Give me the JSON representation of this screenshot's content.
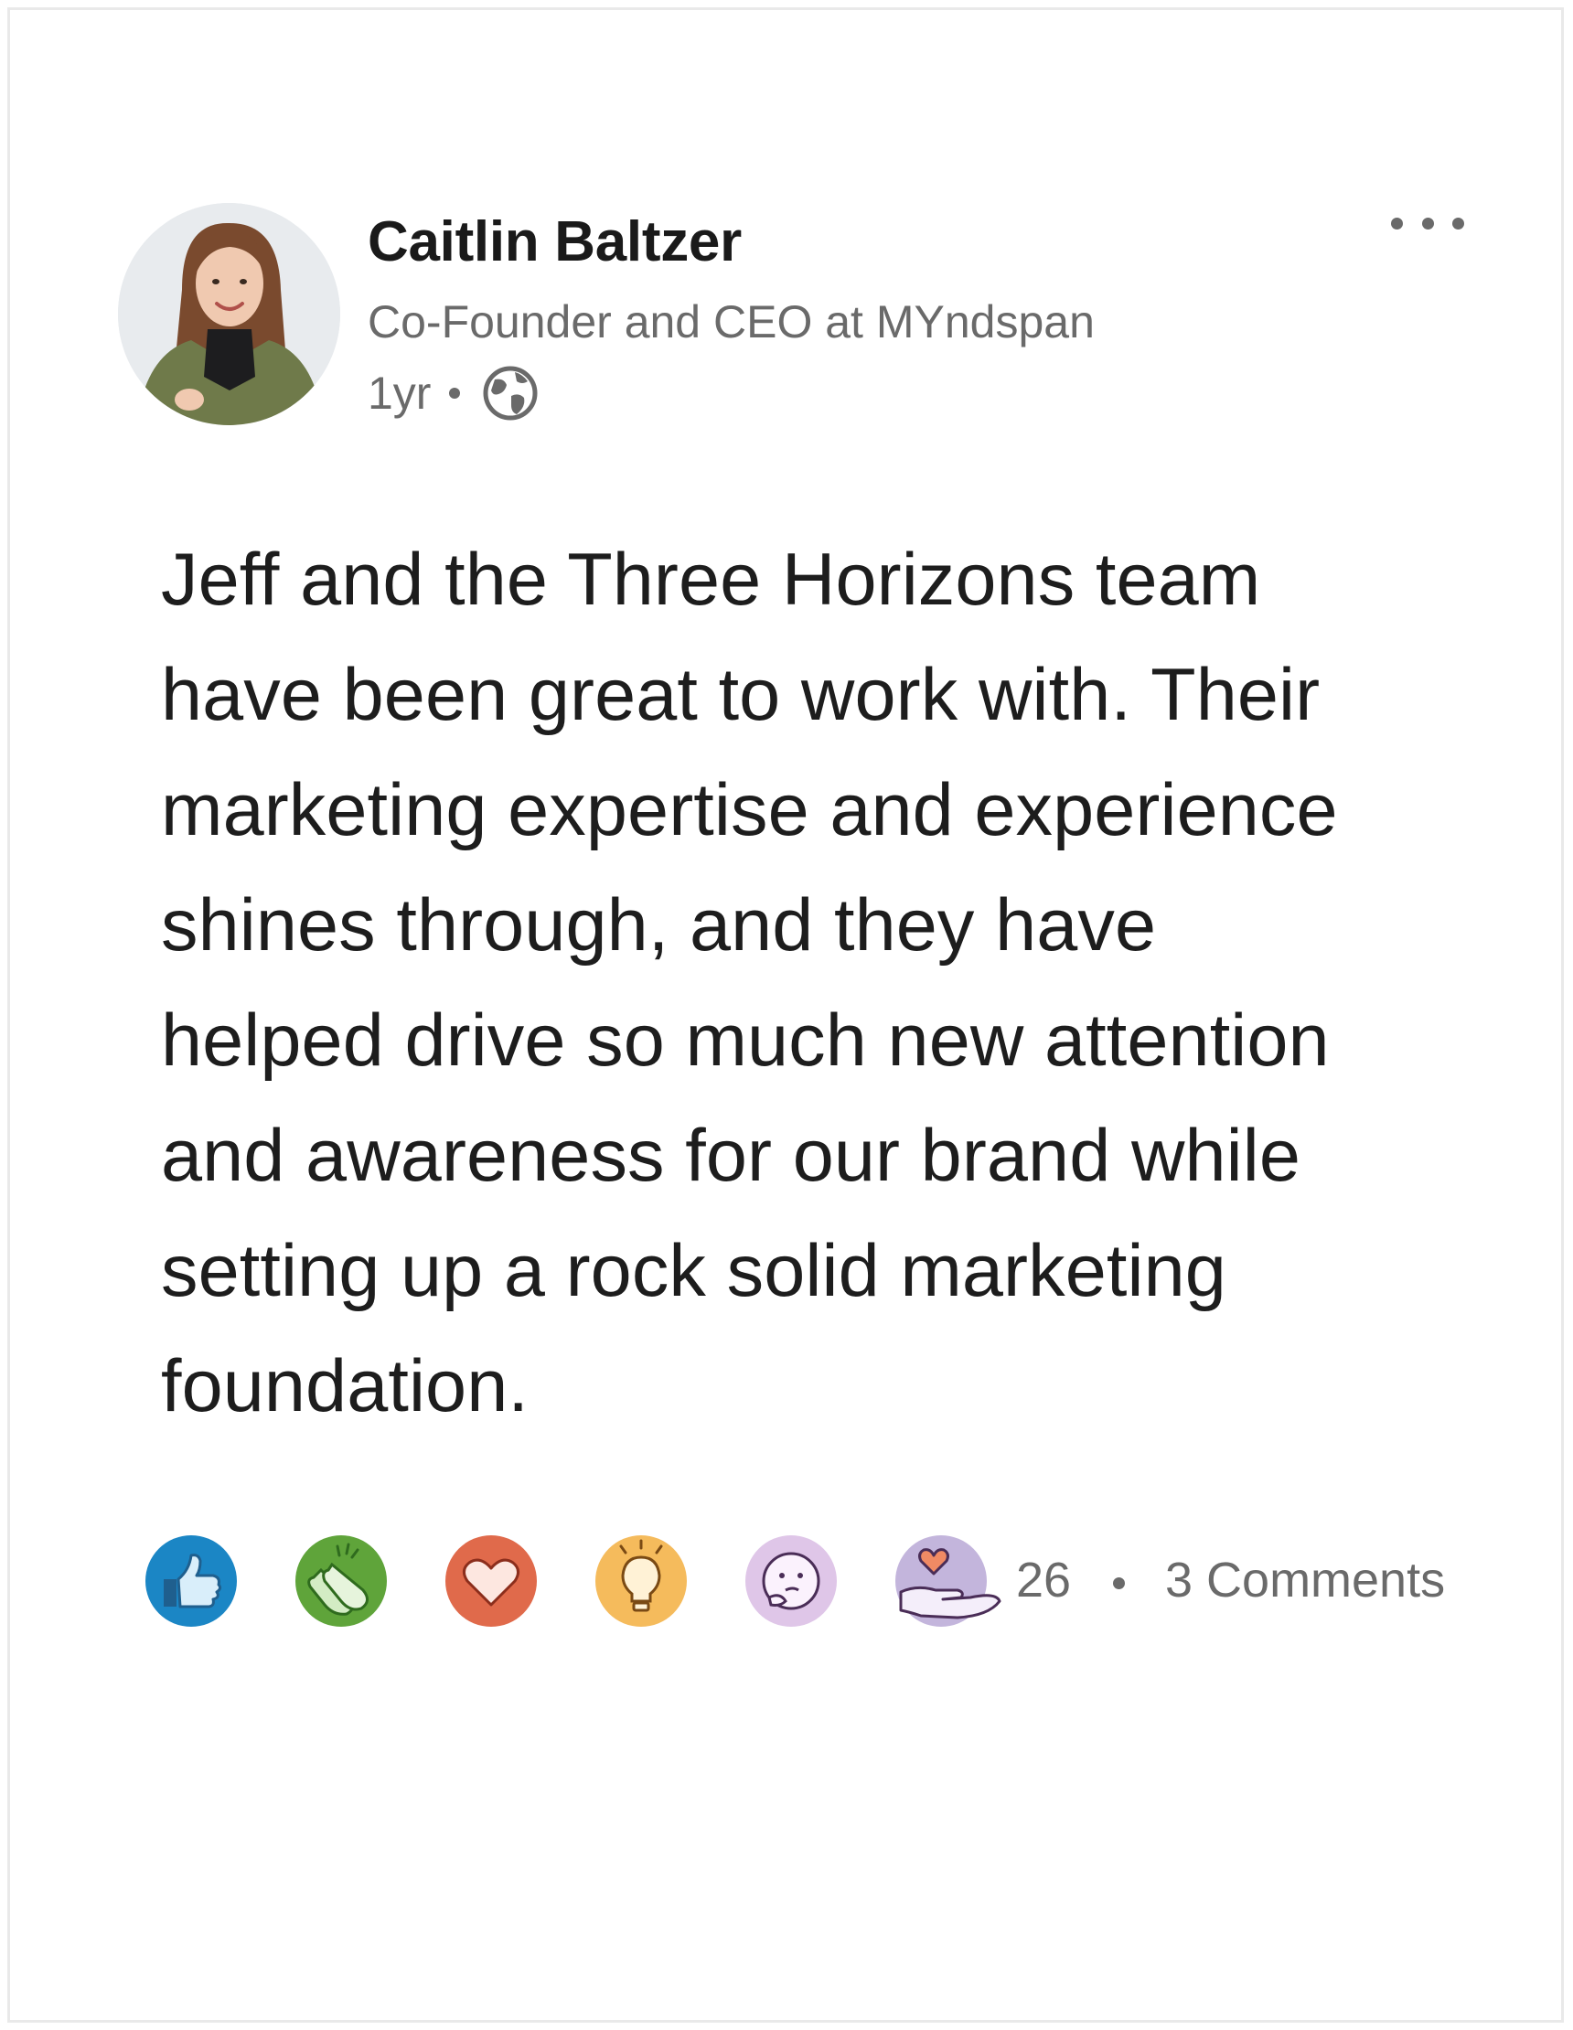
{
  "post": {
    "author": {
      "name": "Caitlin Baltzer",
      "headline": "Co-Founder and CEO at MYndspan",
      "avatar_icon": "profile-photo"
    },
    "meta": {
      "age": "1yr",
      "visibility_icon": "globe-icon"
    },
    "menu_icon": "more-horizontal-icon",
    "body": "Jeff and the Three Horizons team\nhave been great to work with. Their\nmarketing expertise and experience\nshines through, and they have\nhelped drive so much new attention\nand awareness for our brand while\nsetting up a rock solid marketing\nfoundation.",
    "reactions": [
      {
        "type": "like",
        "icon": "thumbs-up-icon",
        "color": "#1b86c5"
      },
      {
        "type": "celebrate",
        "icon": "clapping-hands-icon",
        "color": "#5fa43a"
      },
      {
        "type": "love",
        "icon": "heart-icon",
        "color": "#e06a4b"
      },
      {
        "type": "insightful",
        "icon": "lightbulb-icon",
        "color": "#f5bb5c"
      },
      {
        "type": "curious",
        "icon": "thinking-face-icon",
        "color": "#dfc6e8"
      },
      {
        "type": "support",
        "icon": "heart-in-hand-icon",
        "color": "#c3b5dc"
      }
    ],
    "stats": {
      "reaction_count": "26",
      "comments": "3 Comments"
    }
  }
}
